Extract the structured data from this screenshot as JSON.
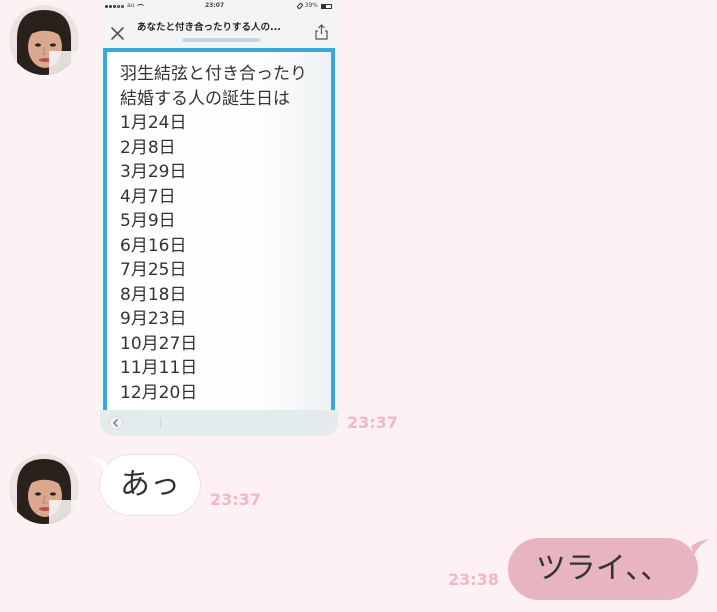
{
  "colors": {
    "background": "#fdf1f4",
    "timestamp": "#f2b6c7",
    "incoming_bubble": "#ffffff",
    "outgoing_bubble": "#e9b4c1",
    "screenshot_frame": "#35a9de"
  },
  "icons": {
    "screenshot_close": "close-icon",
    "screenshot_share": "share-icon",
    "screenshot_back": "back-chevron-icon",
    "status_signal": "signal-icon",
    "status_wifi": "wifi-icon",
    "status_battery": "battery-icon"
  },
  "image_message": {
    "time": "23:37",
    "screenshot": {
      "status_bar": {
        "carrier": "au",
        "time": "23:07",
        "battery": "39%"
      },
      "page_title": "あなたと付き合ったりする人の...",
      "content_lines": [
        "羽生結弦と付き合ったり",
        "結婚する人の誕生日は",
        "1月24日",
        "2月8日",
        "3月29日",
        "4月7日",
        "5月9日",
        "6月16日",
        "7月25日",
        "8月18日",
        "9月23日",
        "10月27日",
        "11月11日",
        "12月20日"
      ]
    }
  },
  "incoming_message": {
    "text": "あっ",
    "time": "23:37"
  },
  "outgoing_message": {
    "text": "ツライ、、",
    "time": "23:38"
  }
}
